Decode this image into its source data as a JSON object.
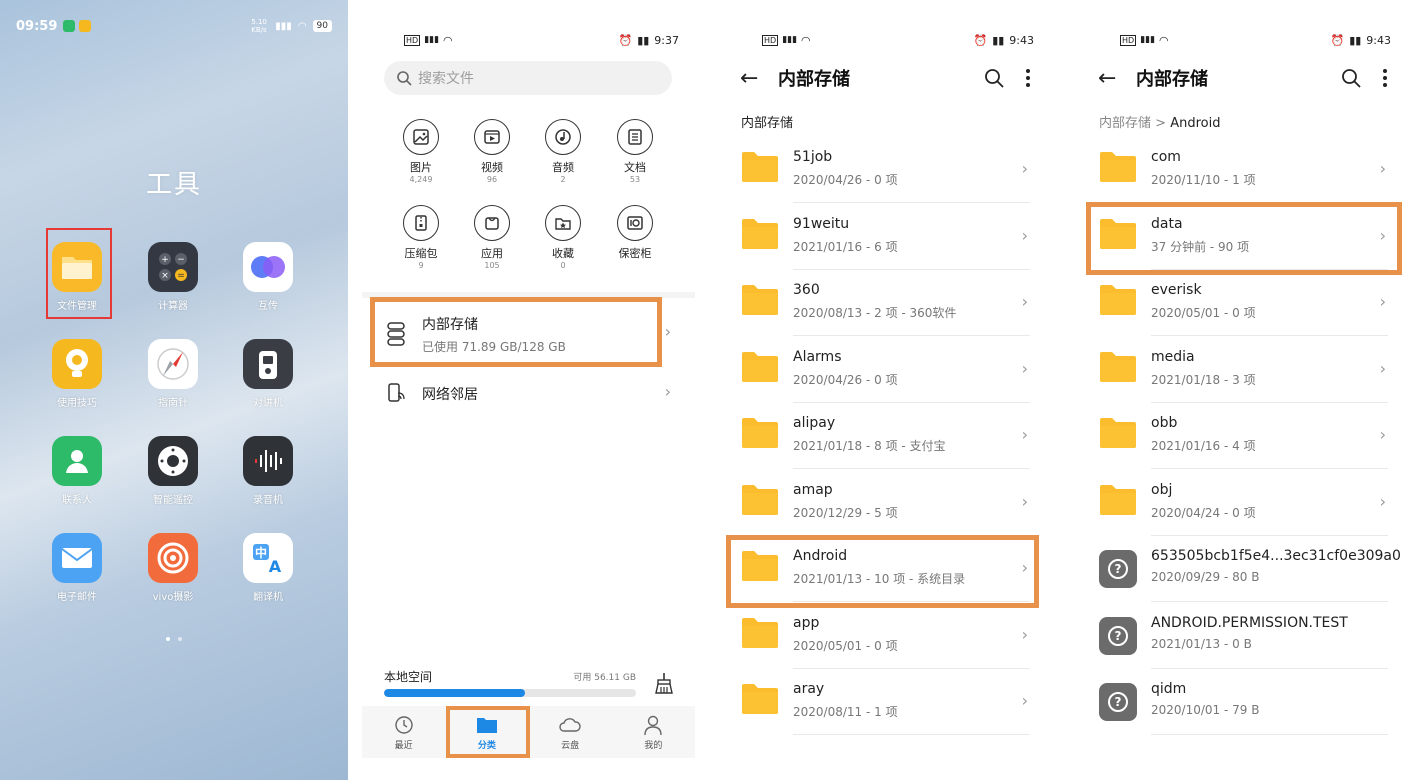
{
  "home": {
    "status_time": "09:59",
    "status_speed": "5.10 KB/s",
    "status_battery": "90",
    "folder_title": "工具",
    "apps": [
      {
        "label": "文件管理",
        "color": "#f9b928"
      },
      {
        "label": "计算器",
        "color": "#333842"
      },
      {
        "label": "互传",
        "color": "#ffffff"
      },
      {
        "label": "使用技巧",
        "color": "#f6b81f"
      },
      {
        "label": "指南针",
        "color": "#ffffff"
      },
      {
        "label": "对讲机",
        "color": "#3a3d44"
      },
      {
        "label": "联系人",
        "color": "#2dbb6a"
      },
      {
        "label": "智能遥控",
        "color": "#2f3237"
      },
      {
        "label": "录音机",
        "color": "#2f3237"
      },
      {
        "label": "电子邮件",
        "color": "#4da3f3"
      },
      {
        "label": "vivo摄影",
        "color": "#f26b3c"
      },
      {
        "label": "翻译机",
        "color": "#ffffff"
      }
    ]
  },
  "files": {
    "status_time": "9:37",
    "search_placeholder": "搜索文件",
    "categories": [
      {
        "name": "图片",
        "count": "4,249",
        "icon": "image-icon"
      },
      {
        "name": "视频",
        "count": "96",
        "icon": "video-icon"
      },
      {
        "name": "音频",
        "count": "2",
        "icon": "audio-icon"
      },
      {
        "name": "文档",
        "count": "53",
        "icon": "document-icon"
      },
      {
        "name": "压缩包",
        "count": "9",
        "icon": "archive-icon"
      },
      {
        "name": "应用",
        "count": "105",
        "icon": "app-package-icon"
      },
      {
        "name": "收藏",
        "count": "0",
        "icon": "favorite-icon"
      },
      {
        "name": "保密柜",
        "count": "",
        "icon": "safe-icon"
      }
    ],
    "internal_storage": {
      "title": "内部存储",
      "usage": "已使用 71.89 GB/128 GB"
    },
    "network": {
      "title": "网络邻居"
    },
    "local_space": {
      "label": "本地空间",
      "available": "可用 56.11 GB",
      "used_fraction": 0.56
    },
    "tabs": [
      {
        "label": "最近",
        "icon": "clock-icon"
      },
      {
        "label": "分类",
        "icon": "folder-icon"
      },
      {
        "label": "云盘",
        "icon": "cloud-icon"
      },
      {
        "label": "我的",
        "icon": "person-icon"
      }
    ]
  },
  "internal": {
    "status_time": "9:43",
    "title": "内部存储",
    "breadcrumb": "内部存储",
    "items": [
      {
        "name": "51job",
        "meta": "2020/04/26 - 0 项"
      },
      {
        "name": "91weitu",
        "meta": "2021/01/16 - 6 项"
      },
      {
        "name": "360",
        "meta": "2020/08/13 - 2 项 - 360软件"
      },
      {
        "name": "Alarms",
        "meta": "2020/04/26 - 0 项"
      },
      {
        "name": "alipay",
        "meta": "2021/01/18 - 8 项 - 支付宝"
      },
      {
        "name": "amap",
        "meta": "2020/12/29 - 5 项"
      },
      {
        "name": "Android",
        "meta": "2021/01/13 - 10 项 - 系统目录"
      },
      {
        "name": "app",
        "meta": "2020/05/01 - 0 项"
      },
      {
        "name": "aray",
        "meta": "2020/08/11 - 1 项"
      }
    ]
  },
  "android": {
    "status_time": "9:43",
    "title": "内部存储",
    "breadcrumb_root": "内部存储",
    "breadcrumb_sep": ">",
    "breadcrumb_current": "Android",
    "items": [
      {
        "name": "com",
        "meta": "2020/11/10 - 1 项",
        "type": "folder"
      },
      {
        "name": "data",
        "meta": "37 分钟前 - 90 项",
        "type": "folder"
      },
      {
        "name": "everisk",
        "meta": "2020/05/01 - 0 项",
        "type": "folder"
      },
      {
        "name": "media",
        "meta": "2021/01/18 - 3 项",
        "type": "folder"
      },
      {
        "name": "obb",
        "meta": "2021/01/16 - 4 项",
        "type": "folder"
      },
      {
        "name": "obj",
        "meta": "2020/04/24 - 0 项",
        "type": "folder"
      },
      {
        "name": "653505bcb1f5e4...3ec31cf0e309a0",
        "meta": "2020/09/29 - 80 B",
        "type": "file"
      },
      {
        "name": "ANDROID.PERMISSION.TEST",
        "meta": "2021/01/13 - 0 B",
        "type": "file"
      },
      {
        "name": "qidm",
        "meta": "2020/10/01 - 79 B",
        "type": "file"
      }
    ]
  },
  "colors": {
    "highlight": "#e8914a",
    "accent": "#1e88e5",
    "folder": "#fbbd2e",
    "home_select": "#e53935"
  }
}
